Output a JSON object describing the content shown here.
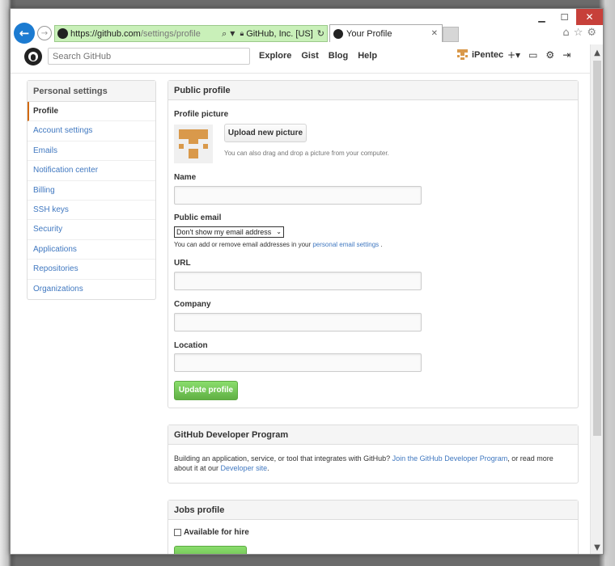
{
  "browser": {
    "url_prefix": "https://github.com",
    "url_path": "/settings/profile",
    "cert": "GitHub, Inc. [US]",
    "tab_title": "Your Profile"
  },
  "header": {
    "search_placeholder": "Search GitHub",
    "nav": [
      "Explore",
      "Gist",
      "Blog",
      "Help"
    ],
    "username": "iPentec"
  },
  "sidebar": {
    "title": "Personal settings",
    "items": [
      "Profile",
      "Account settings",
      "Emails",
      "Notification center",
      "Billing",
      "SSH keys",
      "Security",
      "Applications",
      "Repositories",
      "Organizations"
    ]
  },
  "public_profile": {
    "title": "Public profile",
    "picture_label": "Profile picture",
    "upload_button": "Upload new picture",
    "upload_hint": "You can also drag and drop a picture from your computer.",
    "name_label": "Name",
    "email_label": "Public email",
    "email_selected": "Don't show my email address",
    "email_hint_before": "You can add or remove email addresses in your ",
    "email_hint_link": "personal email settings",
    "email_hint_after": " .",
    "url_label": "URL",
    "company_label": "Company",
    "location_label": "Location",
    "update_button": "Update profile"
  },
  "developer_program": {
    "title": "GitHub Developer Program",
    "text_before": "Building an application, service, or tool that integrates with GitHub? ",
    "link1": "Join the GitHub Developer Program",
    "text_middle": ", or read more about it at our ",
    "link2": "Developer site",
    "text_after": "."
  },
  "jobs_profile": {
    "title": "Jobs profile",
    "checkbox_label": "Available for hire"
  },
  "colors": {
    "accent": "#4078c0",
    "green": "#60b044",
    "avatar": "#d9994b",
    "selected_border": "#d26911"
  }
}
